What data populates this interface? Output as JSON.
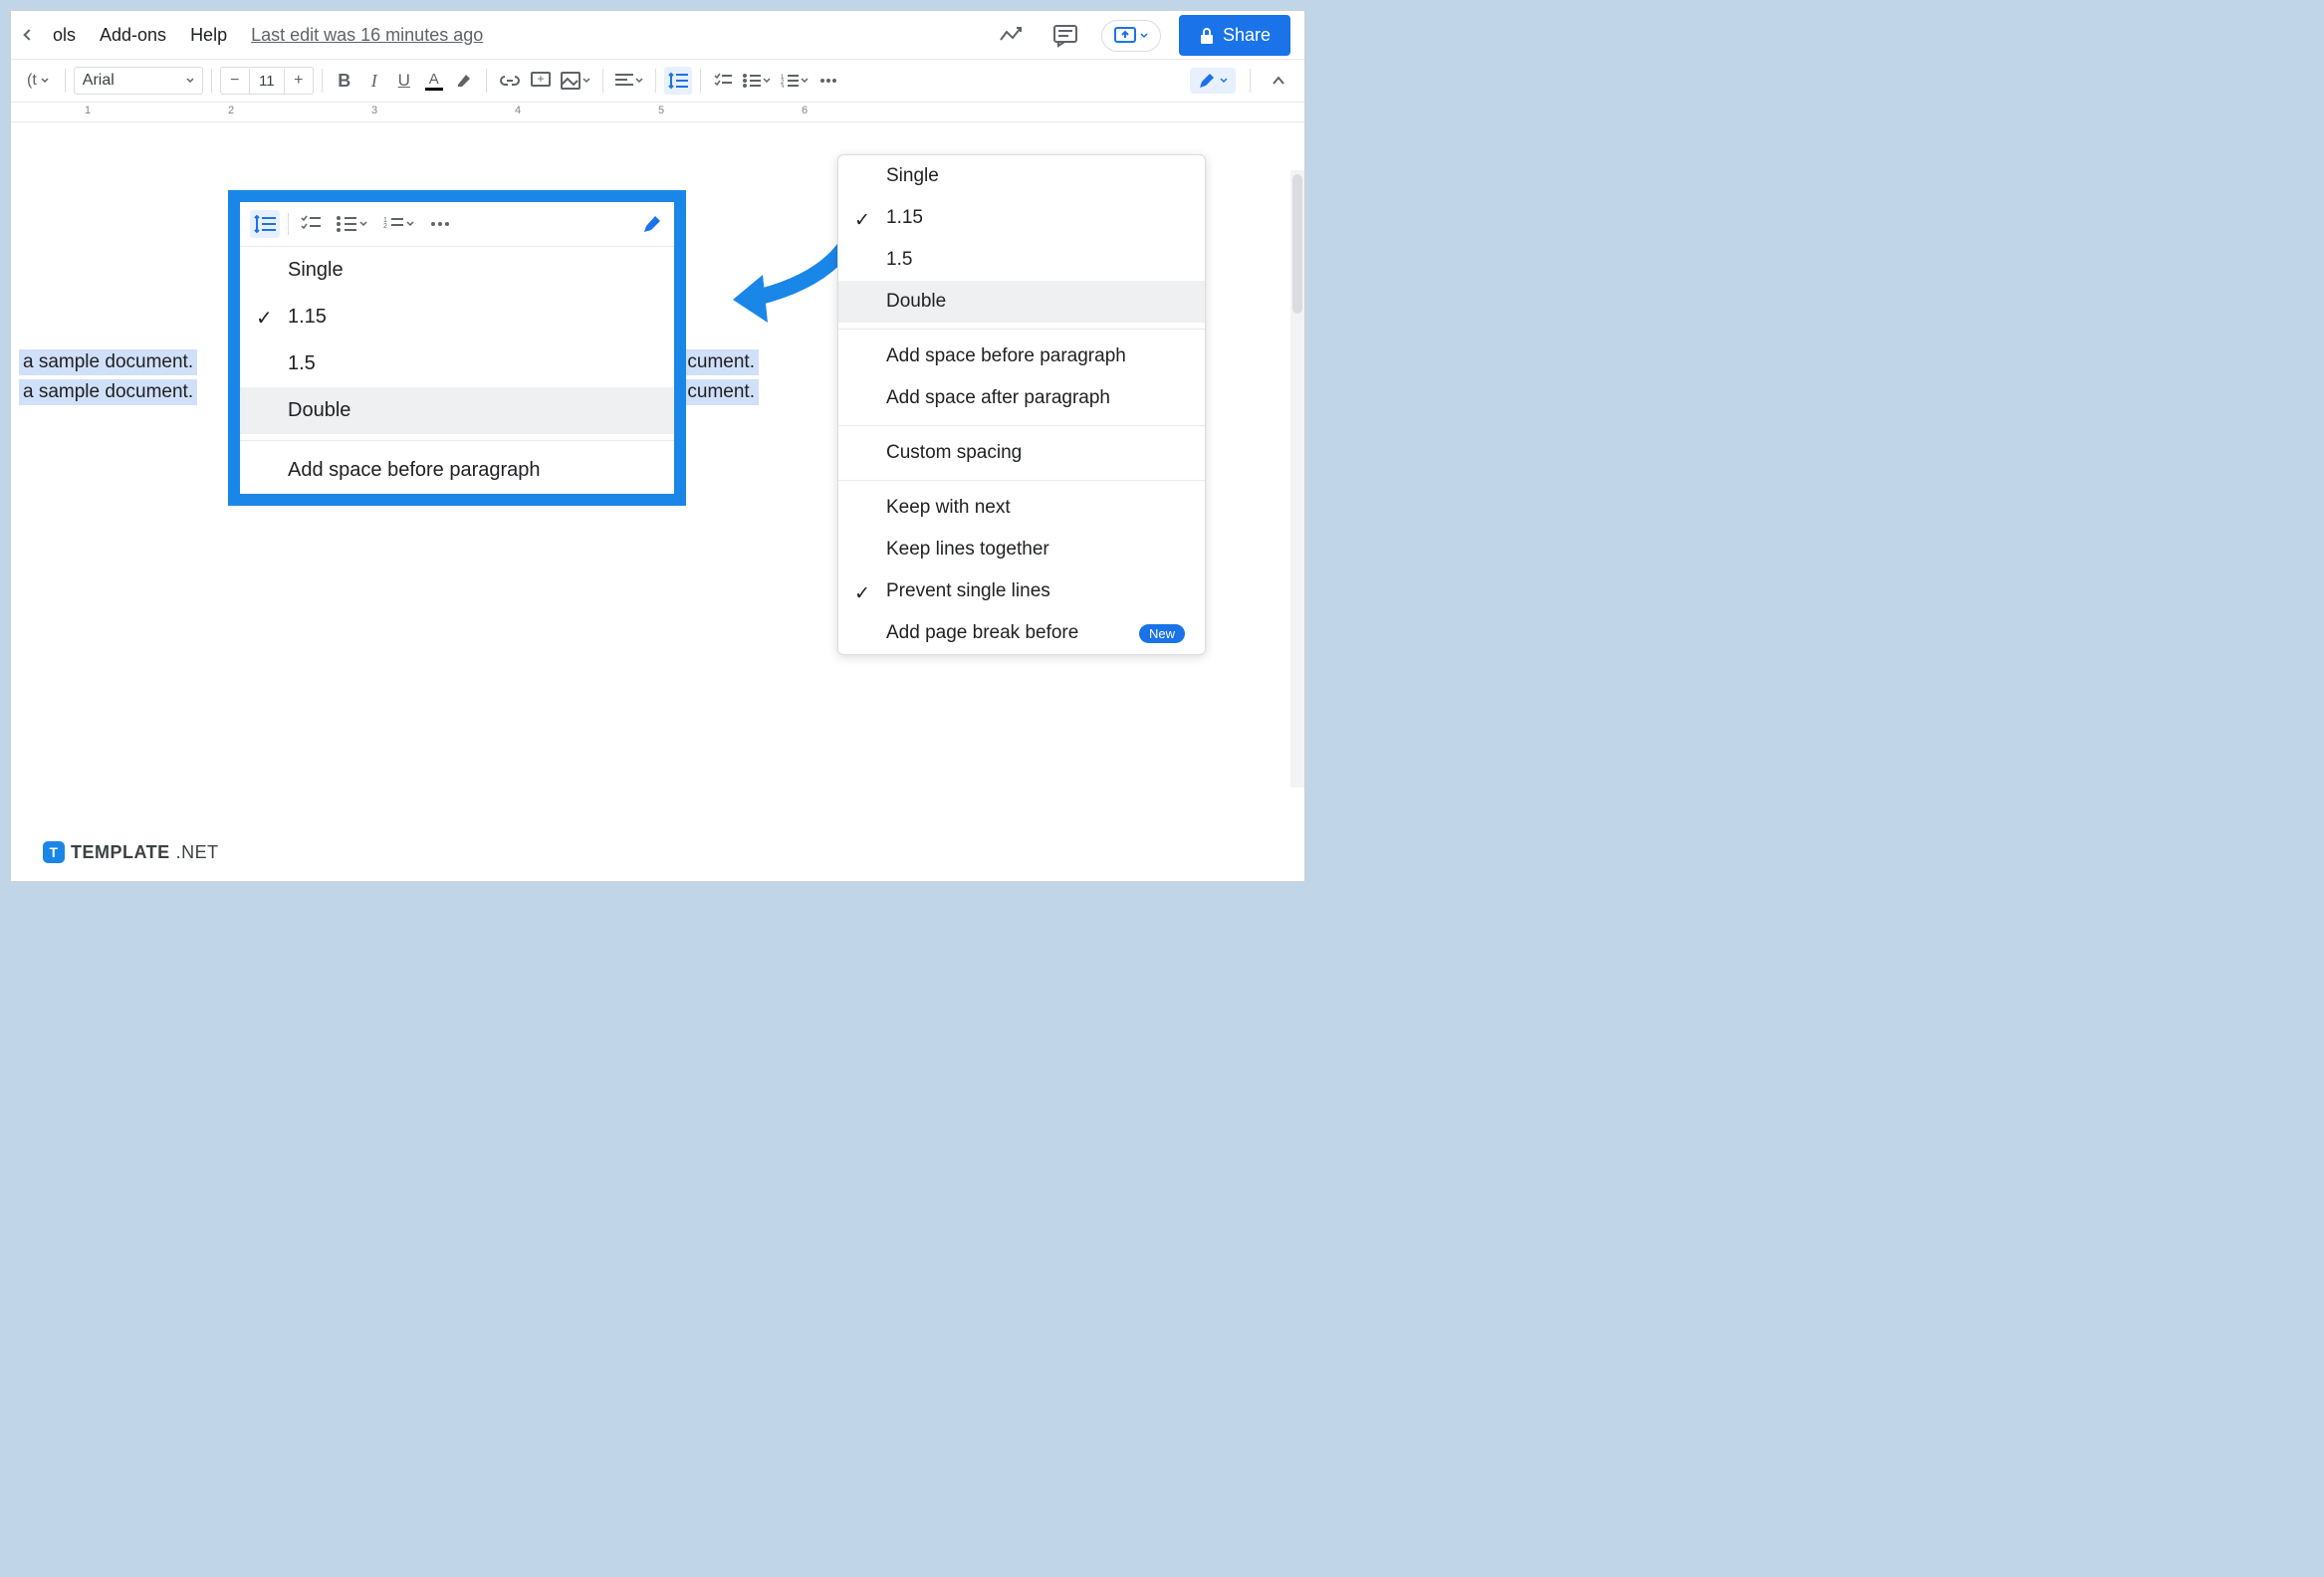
{
  "menus": {
    "tools": "ols",
    "addons": "Add-ons",
    "help": "Help",
    "last_edit": "Last edit was 16 minutes ago"
  },
  "share_label": "Share",
  "toolbar": {
    "styles_label": "(t",
    "font": "Arial",
    "font_size": "11"
  },
  "ruler": [
    "1",
    "2",
    "3",
    "4",
    "5",
    "6"
  ],
  "doc_lines": {
    "l1": "a sample document.",
    "l2": "a sample document.",
    "r1": "cument.",
    "r2": "cument."
  },
  "spacing_menu": {
    "items": [
      {
        "label": "Single",
        "checked": false,
        "hl": false
      },
      {
        "label": "1.15",
        "checked": true,
        "hl": false
      },
      {
        "label": "1.5",
        "checked": false,
        "hl": false
      },
      {
        "label": "Double",
        "checked": false,
        "hl": true
      }
    ],
    "add_before": "Add space before paragraph",
    "add_after": "Add space after paragraph",
    "custom": "Custom spacing",
    "keep_next": "Keep with next",
    "keep_lines": "Keep lines together",
    "prevent": "Prevent single lines",
    "page_break": "Add page break before",
    "new_badge": "New"
  },
  "callout_menu": {
    "items": [
      {
        "label": "Single",
        "checked": false,
        "hl": false
      },
      {
        "label": "1.15",
        "checked": true,
        "hl": false
      },
      {
        "label": "1.5",
        "checked": false,
        "hl": false
      },
      {
        "label": "Double",
        "checked": false,
        "hl": true
      }
    ],
    "add_before": "Add space before paragraph"
  },
  "watermark": {
    "brand": "TEMPLATE",
    "suffix": ".NET",
    "badge": "T"
  }
}
